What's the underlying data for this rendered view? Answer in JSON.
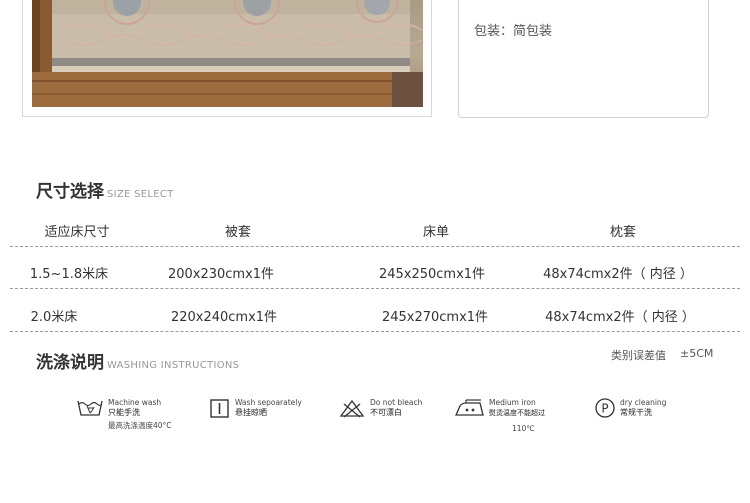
{
  "packaging": {
    "text": "包装：简包装"
  },
  "size_section": {
    "title": "尺寸选择",
    "subtitle": "SIZE SELECT"
  },
  "size_table": {
    "headers": [
      "适应床尺寸",
      "被套",
      "床单",
      "枕套"
    ],
    "rows": [
      [
        "1.5~1.8米床",
        "200x230cmx1件",
        "245x250cmx1件",
        "48x74cmx2件（ 内径 ）"
      ],
      [
        "2.0米床",
        "220x240cmx1件",
        "245x270cmx1件",
        "48x74cmx2件（ 内径 ）"
      ]
    ]
  },
  "wash_section": {
    "title": "洗涤说明",
    "subtitle": "WASHING INSTRUCTIONS"
  },
  "tolerance": {
    "label": "类别误差值",
    "value": "±5CM"
  },
  "wash_items": [
    {
      "icon": "machine-wash-icon",
      "en": "Machine wash",
      "zh": "只能手洗",
      "extra": "最高洗涤温度40°C"
    },
    {
      "icon": "wash-separately-icon",
      "en": "Wash sepoarately",
      "zh": "悬挂晾晒",
      "extra": ""
    },
    {
      "icon": "no-bleach-icon",
      "en": "Do not bleach",
      "zh": "不可漂白",
      "extra": ""
    },
    {
      "icon": "medium-iron-icon",
      "en": "Medium iron",
      "zh": "熨烫温度不能超过",
      "extra": "110℃"
    },
    {
      "icon": "dry-cleaning-icon",
      "en": "dry cleaning",
      "zh": "常规干洗",
      "extra": ""
    }
  ]
}
